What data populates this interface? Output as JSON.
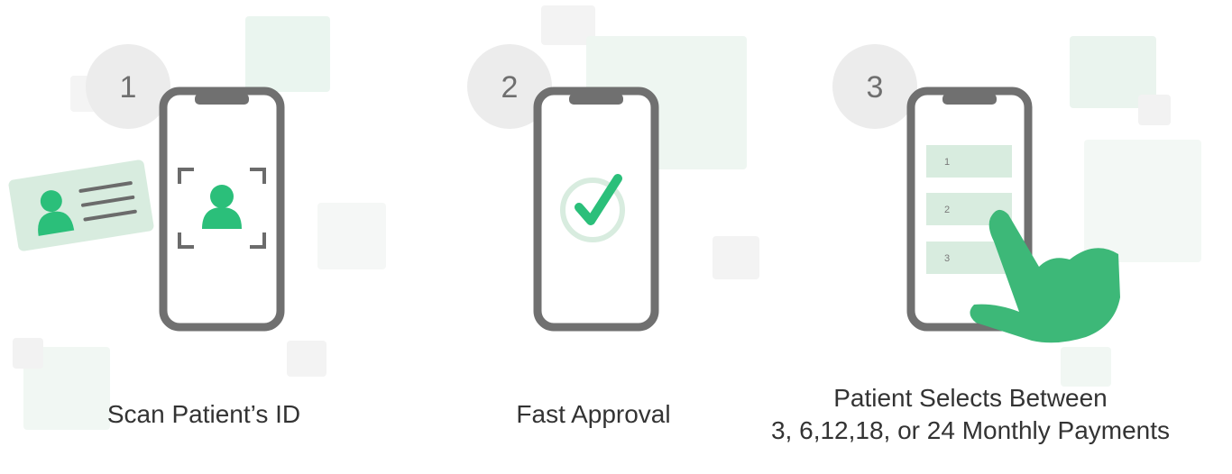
{
  "steps": [
    {
      "number": "1",
      "caption_lines": [
        "Scan Patient’s ID"
      ]
    },
    {
      "number": "2",
      "caption_lines": [
        "Fast Approval"
      ]
    },
    {
      "number": "3",
      "options": [
        "1",
        "2",
        "3"
      ],
      "caption_lines": [
        "Patient Selects Between",
        "3, 6,12,18, or 24 Monthly Payments"
      ]
    }
  ],
  "colors": {
    "accent_green": "#2bbf7a",
    "hand_green": "#3db878",
    "light_green": "#d8ecdf",
    "phone_frame": "#707070",
    "badge_circle": "#ececec",
    "caption_text": "#333333",
    "deco_square": "#eaf4ee"
  },
  "icons": [
    "person-icon",
    "checkmark-icon",
    "pointing-hand-icon",
    "scan-frame-icon",
    "id-card-icon"
  ]
}
